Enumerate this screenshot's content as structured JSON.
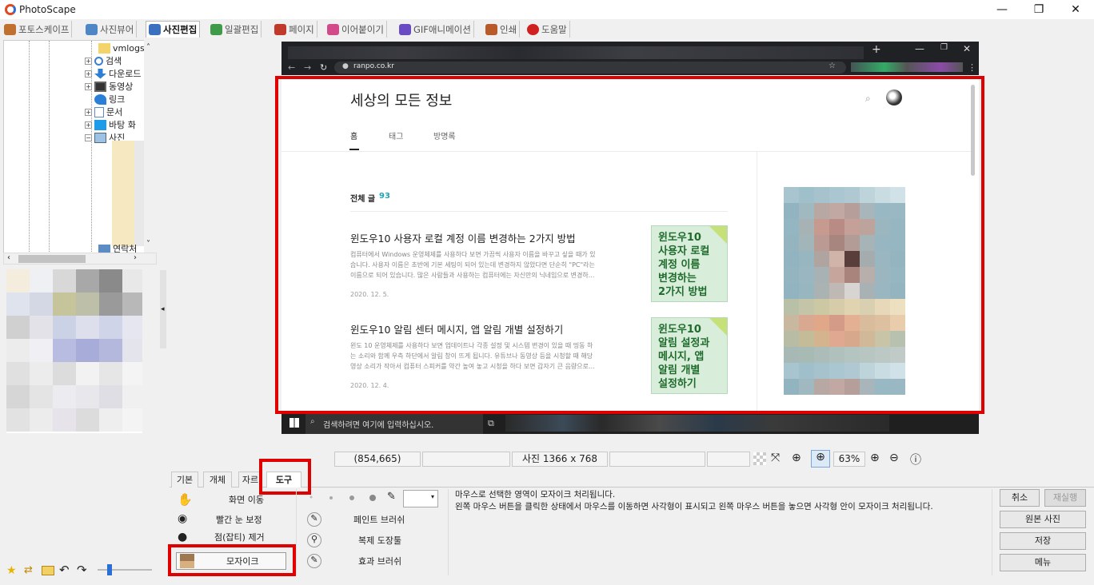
{
  "window": {
    "title": "PhotoScape",
    "minimize": "—",
    "restore": "❐",
    "close": "✕"
  },
  "tabs": [
    {
      "label": "포토스케이프",
      "active": false,
      "color": "#c0712f"
    },
    {
      "label": "사진뷰어",
      "active": false,
      "color": "#4f86c6"
    },
    {
      "label": "사진편집",
      "active": true,
      "color": "#3b6fbf"
    },
    {
      "label": "일괄편집",
      "active": false,
      "color": "#3f9b4a"
    },
    {
      "label": "페이지",
      "active": false,
      "color": "#c0392b"
    },
    {
      "label": "이어붙이기",
      "active": false,
      "color": "#d24a8c"
    },
    {
      "label": "GIF애니메이션",
      "active": false,
      "color": "#6a4bc4"
    },
    {
      "label": "인쇄",
      "active": false,
      "color": "#b85a2a"
    },
    {
      "label": "도움말",
      "active": false,
      "color": "#d02020"
    }
  ],
  "tree": {
    "items": [
      {
        "label": "vmlogs",
        "icon": "folder-icon"
      },
      {
        "label": "검색",
        "icon": "search-icon"
      },
      {
        "label": "다운로드",
        "icon": "download-icon"
      },
      {
        "label": "동영상",
        "icon": "video-icon"
      },
      {
        "label": "링크",
        "icon": "link-icon"
      },
      {
        "label": "문서",
        "icon": "document-icon"
      },
      {
        "label": "바탕 화",
        "icon": "desktop-icon"
      },
      {
        "label": "사진",
        "icon": "pictures-icon"
      },
      {
        "label": "연락처",
        "icon": "contacts-icon"
      }
    ]
  },
  "browser": {
    "url": "ranpo.co.kr",
    "blog_title": "세상의 모든 정보",
    "nav": [
      "홈",
      "태그",
      "방명록"
    ],
    "count_label": "전체 글",
    "count_value": "93",
    "posts": [
      {
        "title": "윈도우10 사용자 로컬 계정 이름 변경하는 2가지 방법",
        "excerpt1": "컴퓨터에서 Windows 운영체제를 사용하다 보면 가끔씩 사용자 이름을 바꾸고 싶을 때가 있",
        "excerpt2": "습니다. 사용자 이름은 초반에 기본 세팅이 되어 있는데 변경하지 않았다면 단순히 \"PC\"라는",
        "excerpt3": "이름으로 되어 있습니다. 많은 사람들과 사용하는 컴퓨터에는 자신만의 닉네임으로 변경하...",
        "date": "2020. 12. 5.",
        "thumb": [
          "윈도우10",
          "사용자 로컬",
          "계정 이름",
          "변경하는",
          "2가지 방법"
        ]
      },
      {
        "title": "윈도우10 알림 센터 메시지, 앱 알림 개별 설정하기",
        "excerpt1": "윈도 10 운영체제를 사용하다 보면 업데이트나 각종 설정 및 시스템 변경이 있을 때 띵동 하",
        "excerpt2": "는 소리와 함께 우측 하단에서 알림 창이 뜨게 됩니다. 유튜브나 동영상 등을 시청할 때 해당",
        "excerpt3": "영상 소리가 작아서 컴퓨터 스피커를 약간 높여 놓고 시청을 하다 보면 갑자기 큰 음량으로...",
        "date": "2020. 12. 4.",
        "thumb": [
          "윈도우10",
          "알림 설정과",
          "메시지, 앱",
          "알림 개별",
          "설정하기"
        ]
      }
    ],
    "taskbar_search": "검색하려면 여기에 입력하십시오."
  },
  "status": {
    "coords": "(854,665)",
    "photo_size": "사진 1366 x 768",
    "zoom": "63%"
  },
  "subtabs": [
    "기본",
    "개체",
    "자르기",
    "도구"
  ],
  "tools_left": [
    "화면 이동",
    "빨간 눈 보정",
    "점(잡티) 제거",
    "모자이크"
  ],
  "tools_right": [
    "페인트 브러쉬",
    "복제 도장툴",
    "효과 브러쉬"
  ],
  "info": {
    "line1": "마우스로 선택한 영역이 모자이크 처리됩니다.",
    "line2": "왼쪽 마우스 버튼을 클릭한 상태에서 마우스를 이동하면 사각형이 표시되고 왼쪽 마우스 버튼을 놓으면 사각형 안이 모자이크 처리됩니다."
  },
  "right_buttons": {
    "cancel": "취소",
    "redo": "재실행",
    "original": "원본 사진",
    "save": "저장",
    "menu": "메뉴"
  },
  "colors": {
    "highlight": "#e00000",
    "accent_teal": "#23a3b5",
    "thumb_bg": "#d8eedb",
    "thumb_text": "#1f6b2c"
  }
}
